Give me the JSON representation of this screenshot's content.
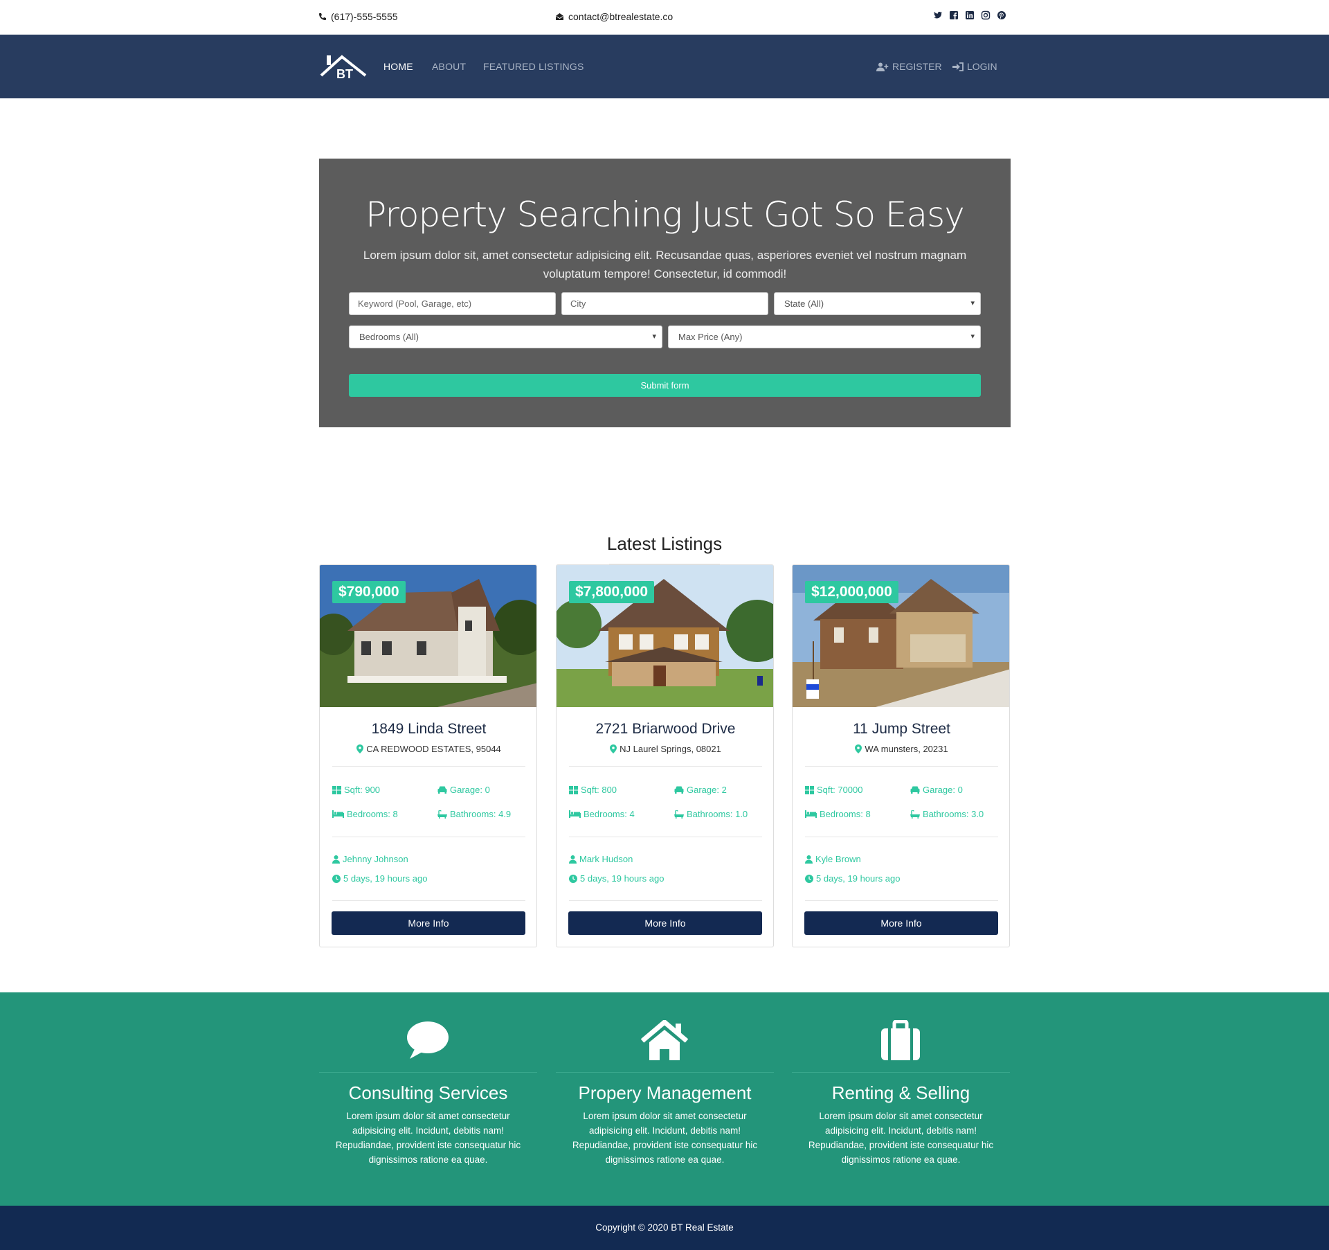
{
  "topbar": {
    "phone": "(617)-555-5555",
    "email": "contact@btrealestate.co",
    "social_icons": [
      "twitter-icon",
      "facebook-icon",
      "linkedin-icon",
      "instagram-icon",
      "pinterest-icon"
    ]
  },
  "navbar": {
    "logo_text": "BT",
    "links": [
      "HOME",
      "ABOUT",
      "FEATURED LISTINGS"
    ],
    "active": "HOME",
    "register_label": "REGISTER",
    "login_label": "LOGIN"
  },
  "hero": {
    "title": "Property Searching Just Got So Easy",
    "lead": "Lorem ipsum dolor sit, amet consectetur adipisicing elit. Recusandae quas, asperiores eveniet vel nostrum magnam voluptatum tempore! Consectetur, id commodi!",
    "keyword_placeholder": "Keyword (Pool, Garage, etc)",
    "city_placeholder": "City",
    "state_selected": "State (All)",
    "bedrooms_selected": "Bedrooms (All)",
    "maxprice_selected": "Max Price (Any)",
    "submit_label": "Submit form"
  },
  "listings": {
    "section_title": "Latest Listings",
    "more_label": "More Info",
    "items": [
      {
        "price": "$790,000",
        "address": "1849 Linda Street",
        "location": "CA REDWOOD ESTATES, 95044",
        "sqft": "Sqft: 900",
        "garage": "Garage: 0",
        "bedrooms": "Bedrooms: 8",
        "bathrooms": "Bathrooms: 4.9",
        "realtor": "Jehnny Johnson",
        "posted": "5 days, 19 hours ago"
      },
      {
        "price": "$7,800,000",
        "address": "2721 Briarwood Drive",
        "location": "NJ Laurel Springs, 08021",
        "sqft": "Sqft: 800",
        "garage": "Garage: 2",
        "bedrooms": "Bedrooms: 4",
        "bathrooms": "Bathrooms: 1.0",
        "realtor": "Mark Hudson",
        "posted": "5 days, 19 hours ago"
      },
      {
        "price": "$12,000,000",
        "address": "11 Jump Street",
        "location": "WA munsters, 20231",
        "sqft": "Sqft: 70000",
        "garage": "Garage: 0",
        "bedrooms": "Bedrooms: 8",
        "bathrooms": "Bathrooms: 3.0",
        "realtor": "Kyle Brown",
        "posted": "5 days, 19 hours ago"
      }
    ]
  },
  "services": [
    {
      "icon": "speech-bubble-icon",
      "title": "Consulting Services",
      "text": "Lorem ipsum dolor sit amet consectetur adipisicing elit. Incidunt, debitis nam! Repudiandae, provident iste consequatur hic dignissimos ratione ea quae."
    },
    {
      "icon": "house-icon",
      "title": "Propery Management",
      "text": "Lorem ipsum dolor sit amet consectetur adipisicing elit. Incidunt, debitis nam! Repudiandae, provident iste consequatur hic dignissimos ratione ea quae."
    },
    {
      "icon": "suitcase-icon",
      "title": "Renting & Selling",
      "text": "Lorem ipsum dolor sit amet consectetur adipisicing elit. Incidunt, debitis nam! Repudiandae, provident iste consequatur hic dignissimos ratione ea quae."
    }
  ],
  "footer": {
    "copyright": "Copyright © 2020 BT Real Estate"
  },
  "colors": {
    "navy": "#283c5f",
    "accent": "#2ec8a0",
    "services_bg": "#23957a",
    "footer_bg": "#122a52",
    "button_dark": "#132952"
  }
}
